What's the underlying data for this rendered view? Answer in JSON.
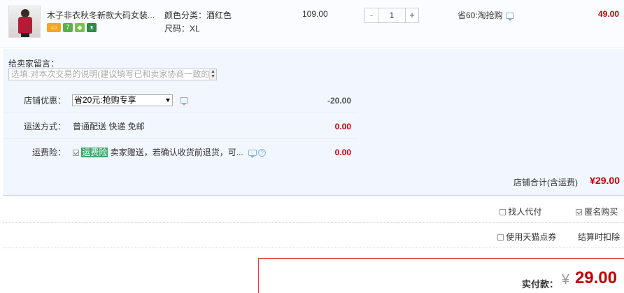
{
  "item": {
    "title": "木子非衣秋冬新款大码女装...",
    "sku_color": "颜色分类：酒红色",
    "sku_size": "尺码：XL",
    "unit_price": "109.00",
    "quantity": "1",
    "minus": "-",
    "plus": "+",
    "promo": "省60:淘抢购",
    "subtotal": "49.00",
    "badges": [
      "card-icon",
      "seven-day-return-icon",
      "shield-icon",
      "tmall-cat-icon"
    ]
  },
  "message": {
    "label": "给卖家留言：",
    "placeholder": "选填:对本次交易的说明(建议填写已和卖家协商一致的内容)"
  },
  "coupon": {
    "label": "店铺优惠：",
    "selected": "省20元:抢购专享",
    "amount": "-20.00"
  },
  "shipping": {
    "label": "运送方式：",
    "value": "普通配送 快递 免邮",
    "amount": "0.00"
  },
  "insurance": {
    "label": "运费险：",
    "tag": "运费险",
    "desc": "卖家赠送，若确认收货前退货，可...",
    "help": "?",
    "amount": "0.00"
  },
  "shop_total": {
    "label": "店铺合计(含运费)",
    "value": "¥29.00"
  },
  "options": {
    "proxy_pay": "找人代付",
    "anonymous": "匿名购买",
    "tmall_points": "使用天猫点券",
    "deduct_note": "结算时扣除"
  },
  "payment": {
    "label": "实付款：",
    "currency": "¥",
    "amount": "29.00"
  },
  "colors": {
    "price_red": "#c40000",
    "panel_bg": "#f2f7ff",
    "tag_green": "#3aa66b"
  }
}
